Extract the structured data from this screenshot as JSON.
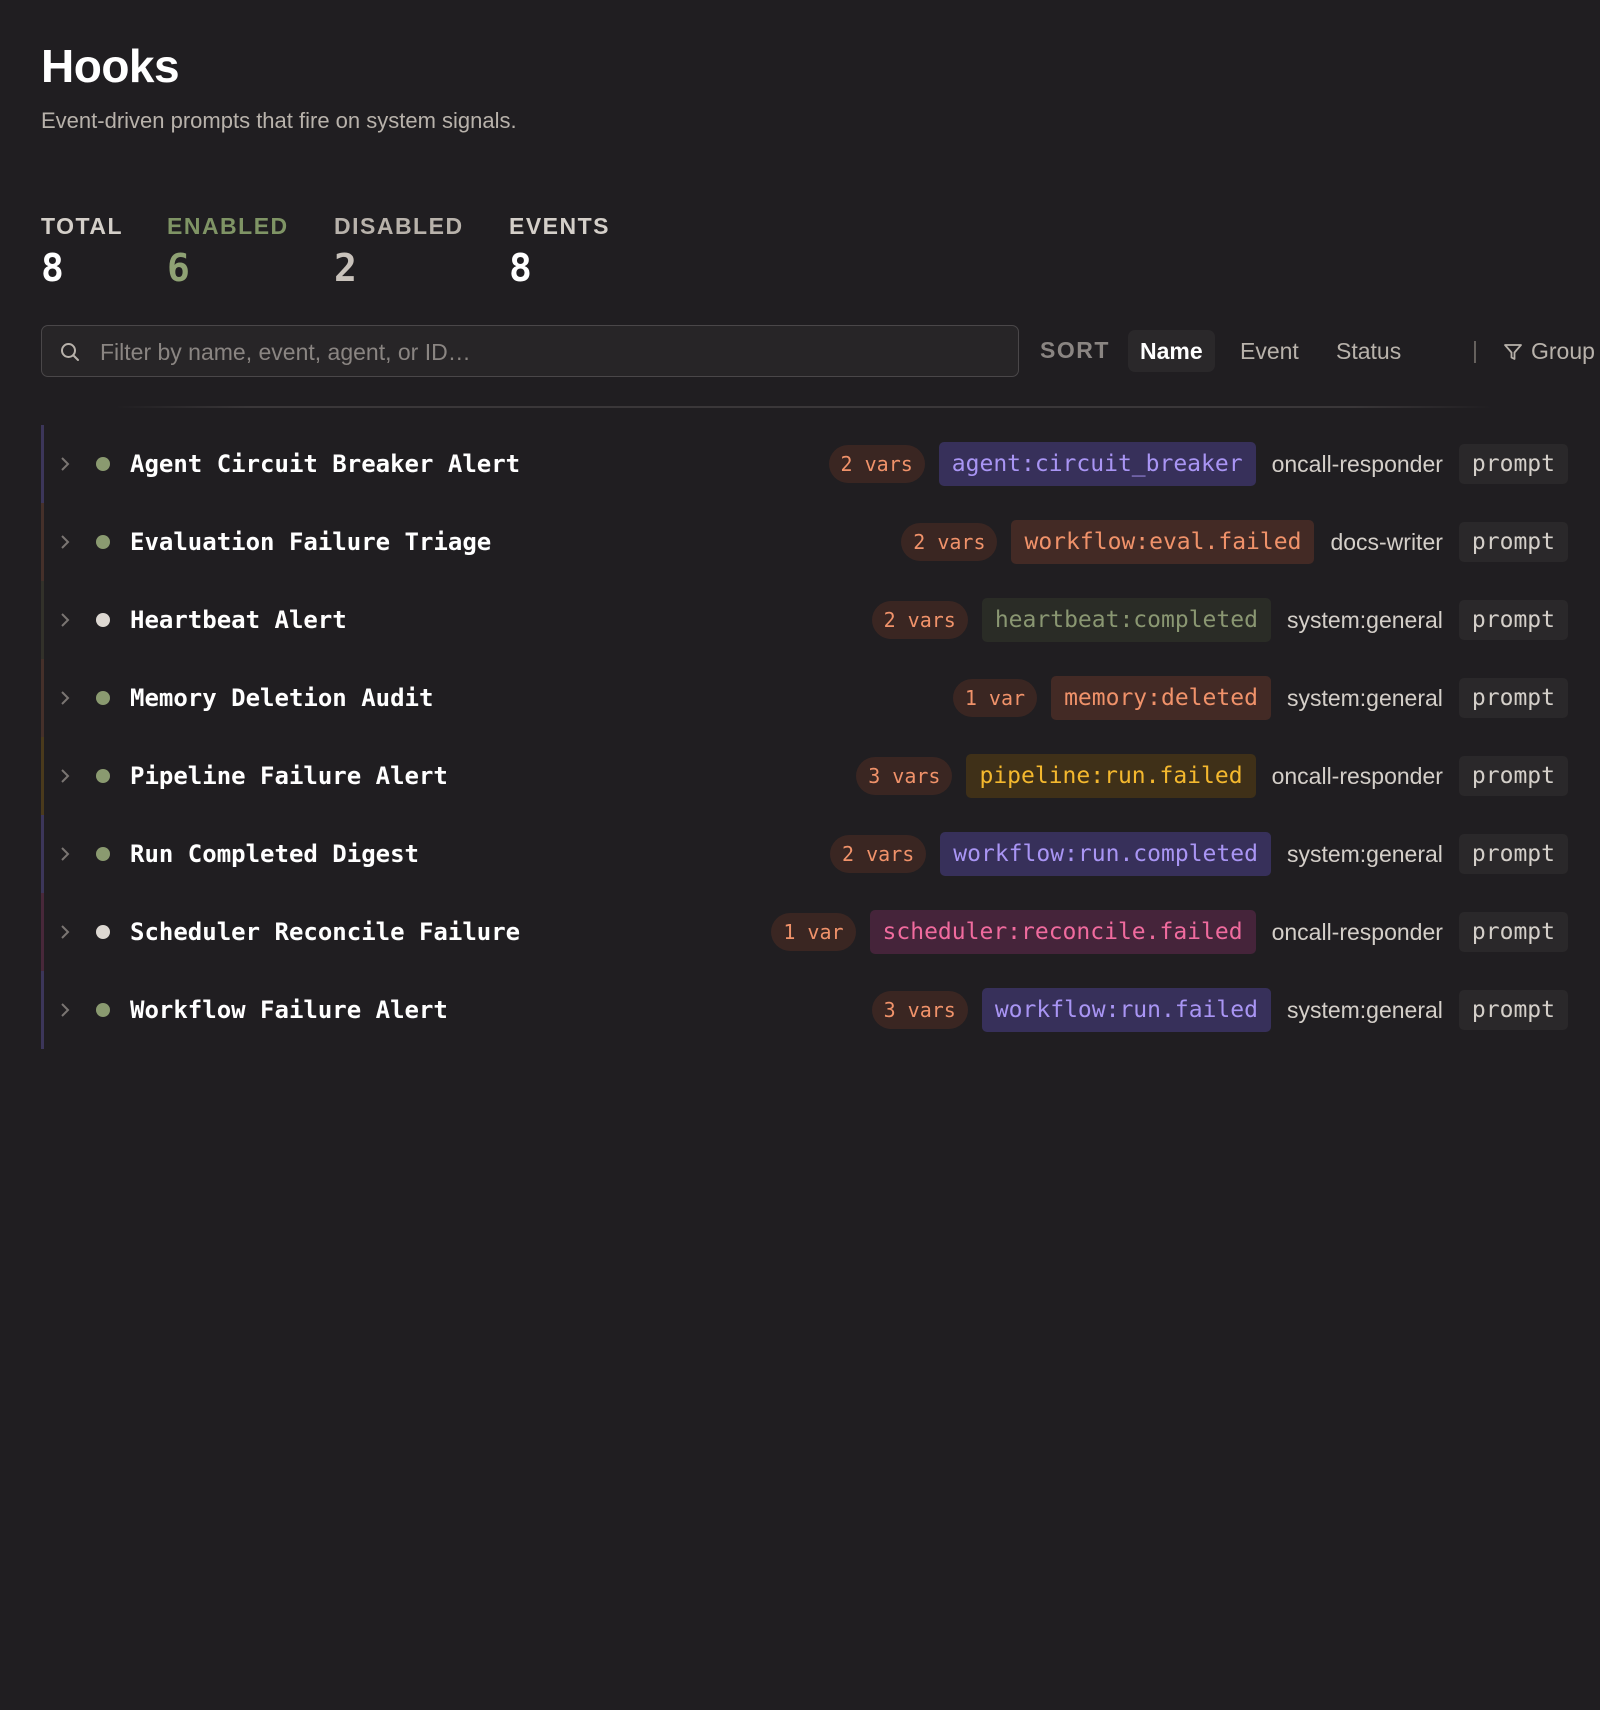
{
  "header": {
    "title": "Hooks",
    "subtitle": "Event-driven prompts that fire on system signals."
  },
  "stats": [
    {
      "label": "TOTAL",
      "value": "8",
      "color": "#d4cfc9",
      "value_color": "#ffffff"
    },
    {
      "label": "ENABLED",
      "value": "6",
      "color": "#7f9465",
      "value_color": "#8fa274"
    },
    {
      "label": "DISABLED",
      "value": "2",
      "color": "#b8b2ab",
      "value_color": "#c8c2bb"
    },
    {
      "label": "EVENTS",
      "value": "8",
      "color": "#d4cfc9",
      "value_color": "#ffffff"
    }
  ],
  "search": {
    "placeholder": "Filter by name, event, agent, or ID…",
    "icon": "search-icon"
  },
  "sort": {
    "label": "SORT",
    "options": [
      "Name",
      "Event",
      "Status"
    ],
    "active": "Name",
    "divider": "|",
    "group_label": "Group",
    "group_icon": "filter-icon"
  },
  "hooks": [
    {
      "name": "Agent Circuit Breaker Alert",
      "enabled": true,
      "vars": "2 vars",
      "event": "agent:circuit_breaker",
      "event_color": "#a995f4",
      "event_bg": "#37305a",
      "accent": "#3c365a",
      "agent": "oncall-responder",
      "type": "prompt"
    },
    {
      "name": "Evaluation Failure Triage",
      "enabled": true,
      "vars": "2 vars",
      "event": "workflow:eval.failed",
      "event_color": "#f0926a",
      "event_bg": "#432a25",
      "accent": "#45302a",
      "agent": "docs-writer",
      "type": "prompt"
    },
    {
      "name": "Heartbeat Alert",
      "enabled": false,
      "vars": "2 vars",
      "event": "heartbeat:completed",
      "event_color": "#8a9772",
      "event_bg": "#2a2c26",
      "accent": "#32312a",
      "agent": "system:general",
      "type": "prompt"
    },
    {
      "name": "Memory Deletion Audit",
      "enabled": true,
      "vars": "1 var",
      "event": "memory:deleted",
      "event_color": "#f0926a",
      "event_bg": "#432a25",
      "accent": "#45302a",
      "agent": "system:general",
      "type": "prompt"
    },
    {
      "name": "Pipeline Failure Alert",
      "enabled": true,
      "vars": "3 vars",
      "event": "pipeline:run.failed",
      "event_color": "#f4b82e",
      "event_bg": "#3f3018",
      "accent": "#4a3a1c",
      "agent": "oncall-responder",
      "type": "prompt"
    },
    {
      "name": "Run Completed Digest",
      "enabled": true,
      "vars": "2 vars",
      "event": "workflow:run.completed",
      "event_color": "#a995f4",
      "event_bg": "#37305a",
      "accent": "#3c365a",
      "agent": "system:general",
      "type": "prompt"
    },
    {
      "name": "Scheduler Reconcile Failure",
      "enabled": false,
      "vars": "1 var",
      "event": "scheduler:reconcile.failed",
      "event_color": "#f06b9e",
      "event_bg": "#45243a",
      "accent": "#48283a",
      "agent": "oncall-responder",
      "type": "prompt"
    },
    {
      "name": "Workflow Failure Alert",
      "enabled": true,
      "vars": "3 vars",
      "event": "workflow:run.failed",
      "event_color": "#a995f4",
      "event_bg": "#37305a",
      "accent": "#3c365a",
      "agent": "system:general",
      "type": "prompt"
    }
  ],
  "colors": {
    "background": "#201e21",
    "enabled_dot": "#8a9a70",
    "disabled_dot": "#ddd8d2",
    "vars_text": "#f0926a",
    "vars_bg": "#3a2622"
  }
}
